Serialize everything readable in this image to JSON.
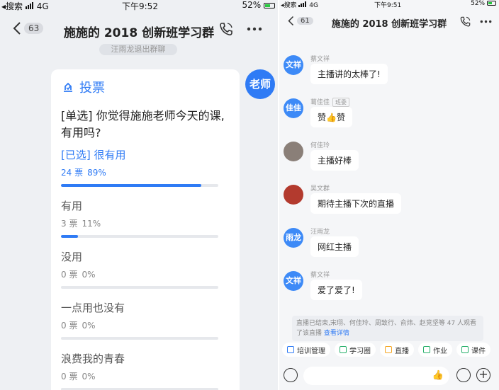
{
  "left": {
    "status": {
      "carrier": "搜索",
      "network": "4G",
      "time": "下午9:52",
      "battery": "52%"
    },
    "nav": {
      "back_count": "63",
      "title": "施施的 2018 创新班学习群"
    },
    "system_pill": "汪雨龙退出群聊",
    "teacher_avatar": "老师",
    "poll": {
      "header": "投票",
      "question": "[单选] 你觉得施施老师今天的课,有用吗?",
      "options": [
        {
          "label": "[已选] 很有用",
          "votes": "24 票",
          "percent": "89%",
          "fraction": 0.89,
          "selected": true
        },
        {
          "label": "有用",
          "votes": "3 票",
          "percent": "11%",
          "fraction": 0.11,
          "selected": false
        },
        {
          "label": "没用",
          "votes": "0 票",
          "percent": "0%",
          "fraction": 0,
          "selected": false
        },
        {
          "label": "一点用也没有",
          "votes": "0 票",
          "percent": "0%",
          "fraction": 0,
          "selected": false
        },
        {
          "label": "浪费我的青春",
          "votes": "0 票",
          "percent": "0%",
          "fraction": 0,
          "selected": false
        }
      ]
    }
  },
  "right": {
    "status": {
      "carrier": "搜索",
      "network": "4G",
      "time": "下午9:51",
      "battery": "52%"
    },
    "nav": {
      "back_count": "61",
      "title": "施施的 2018 创新班学习群"
    },
    "messages": [
      {
        "sender": "蔡文祥",
        "avatar_text": "文祥",
        "text": "主播讲的太棒了!",
        "avatar_color": "#3d8af7",
        "role": ""
      },
      {
        "sender": "葛佳佳",
        "avatar_text": "佳佳",
        "text": "赞👍赞",
        "avatar_color": "#3d8af7",
        "role": "班委"
      },
      {
        "sender": "何佳玲",
        "avatar_text": "",
        "text": "主播好棒",
        "avatar_color": "#8a7f78",
        "role": ""
      },
      {
        "sender": "吴文群",
        "avatar_text": "",
        "text": "期待主播下次的直播",
        "avatar_color": "#b33a2e",
        "role": ""
      },
      {
        "sender": "汪雨龙",
        "avatar_text": "雨龙",
        "text": "网红主播",
        "avatar_color": "#3d8af7",
        "role": ""
      },
      {
        "sender": "蔡文祥",
        "avatar_text": "文祥",
        "text": "爱了爱了!",
        "avatar_color": "#3d8af7",
        "role": ""
      }
    ],
    "live_note": {
      "text": "直播已结束,宋珝、何佳玲、周致行、俞炜、赵竞坚等 47 人观看了该直播",
      "link": "查看详情"
    },
    "quick_actions": [
      {
        "label": "培训管理",
        "color": "#2f7bf5"
      },
      {
        "label": "学习圈",
        "color": "#27b06b"
      },
      {
        "label": "直播",
        "color": "#f5a623"
      },
      {
        "label": "作业",
        "color": "#27b06b"
      },
      {
        "label": "课件",
        "color": "#27b06b"
      }
    ]
  }
}
